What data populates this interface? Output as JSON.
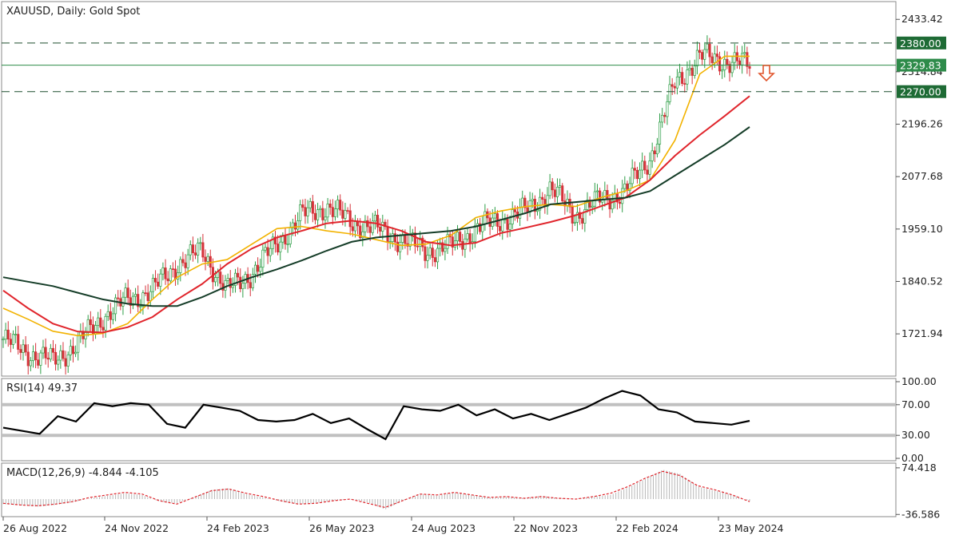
{
  "chart_data": {
    "type": "candlestick",
    "symbol_label": "XAUUSD, Daily:  Gold Spot",
    "price_ticks": [
      "2433.42",
      "2314.84",
      "2196.26",
      "2077.68",
      "1959.10",
      "1840.52",
      "1721.94"
    ],
    "x_ticks": [
      "26 Aug 2022",
      "24 Nov 2022",
      "24 Feb 2023",
      "26 May 2023",
      "24 Aug 2023",
      "22 Nov 2023",
      "22 Feb 2024",
      "23 May 2024"
    ],
    "levels": [
      {
        "value": 2380.0,
        "label": "2380.00",
        "style": "dashed",
        "color": "#1f4e2f",
        "box_color": "#1e6b35"
      },
      {
        "value": 2329.83,
        "label": "2329.83",
        "style": "solid",
        "color": "#2e8b4a",
        "box_color": "#2e8b4a"
      },
      {
        "value": 2270.0,
        "label": "2270.00",
        "style": "dashed",
        "color": "#1f4e2f",
        "box_color": "#1e6b35"
      }
    ],
    "annotation": "down-arrow",
    "ma_series": [
      {
        "color": "#f2b200",
        "values": [
          1780,
          1755,
          1728,
          1718,
          1723,
          1745,
          1800,
          1850,
          1880,
          1890,
          1925,
          1960,
          1965,
          1955,
          1948,
          1935,
          1922,
          1925,
          1945,
          1985,
          2000,
          2010,
          2015,
          2010,
          2030,
          2045,
          2070,
          2160,
          2310,
          2350,
          2350
        ]
      },
      {
        "color": "#e0242b",
        "values": [
          1820,
          1780,
          1745,
          1727,
          1725,
          1737,
          1760,
          1800,
          1835,
          1880,
          1915,
          1940,
          1955,
          1972,
          1978,
          1972,
          1955,
          1930,
          1922,
          1928,
          1950,
          1962,
          1975,
          1990,
          2010,
          2030,
          2070,
          2125,
          2172,
          2215,
          2260
        ]
      },
      {
        "color": "#153d28",
        "values": [
          1850,
          1840,
          1830,
          1815,
          1800,
          1790,
          1785,
          1785,
          1805,
          1830,
          1850,
          1868,
          1888,
          1910,
          1930,
          1940,
          1945,
          1950,
          1955,
          1965,
          1980,
          1995,
          2015,
          2020,
          2025,
          2030,
          2045,
          2080,
          2115,
          2150,
          2190
        ]
      }
    ],
    "close_series": [
      1710,
      1680,
      1660,
      1700,
      1760,
      1800,
      1820,
      1880,
      1910,
      1820,
      1860,
      1925,
      1990,
      2010,
      1975,
      1960,
      1935,
      1910,
      1920,
      1960,
      1980,
      2000,
      2050,
      1990,
      2025,
      2045,
      2120,
      2290,
      2350,
      2340,
      2330
    ],
    "rsi": {
      "label": "RSI(14) 49.37",
      "ticks": [
        "100.00",
        "70.00",
        "30.00",
        "0.00"
      ],
      "levels": [
        70,
        30
      ],
      "values": [
        40,
        36,
        32,
        55,
        48,
        72,
        68,
        72,
        70,
        45,
        40,
        70,
        66,
        62,
        50,
        48,
        50,
        58,
        46,
        52,
        38,
        25,
        68,
        64,
        62,
        70,
        56,
        64,
        52,
        58,
        50,
        58,
        66,
        78,
        88,
        82,
        64,
        60,
        48,
        46,
        44,
        49
      ]
    },
    "macd": {
      "label": "MACD(12,26,9) -4.844 -4.105",
      "ticks": [
        "74.418",
        "-36.586"
      ],
      "hist": [
        -12,
        -15,
        -18,
        -14,
        -8,
        2,
        8,
        14,
        10,
        -6,
        -10,
        5,
        22,
        26,
        12,
        4,
        -6,
        -12,
        -10,
        -4,
        0,
        -8,
        -25,
        -5,
        12,
        8,
        16,
        10,
        4,
        6,
        2,
        8,
        2,
        0,
        6,
        10,
        28,
        48,
        70,
        60,
        30,
        20,
        10,
        -5
      ],
      "signal": [
        -10,
        -14,
        -16,
        -12,
        -6,
        4,
        10,
        16,
        12,
        -4,
        -12,
        4,
        20,
        24,
        14,
        6,
        -4,
        -12,
        -10,
        -4,
        0,
        -10,
        -20,
        -4,
        12,
        10,
        16,
        10,
        4,
        6,
        2,
        6,
        2,
        0,
        6,
        14,
        30,
        50,
        66,
        56,
        32,
        22,
        10,
        -6
      ]
    }
  }
}
